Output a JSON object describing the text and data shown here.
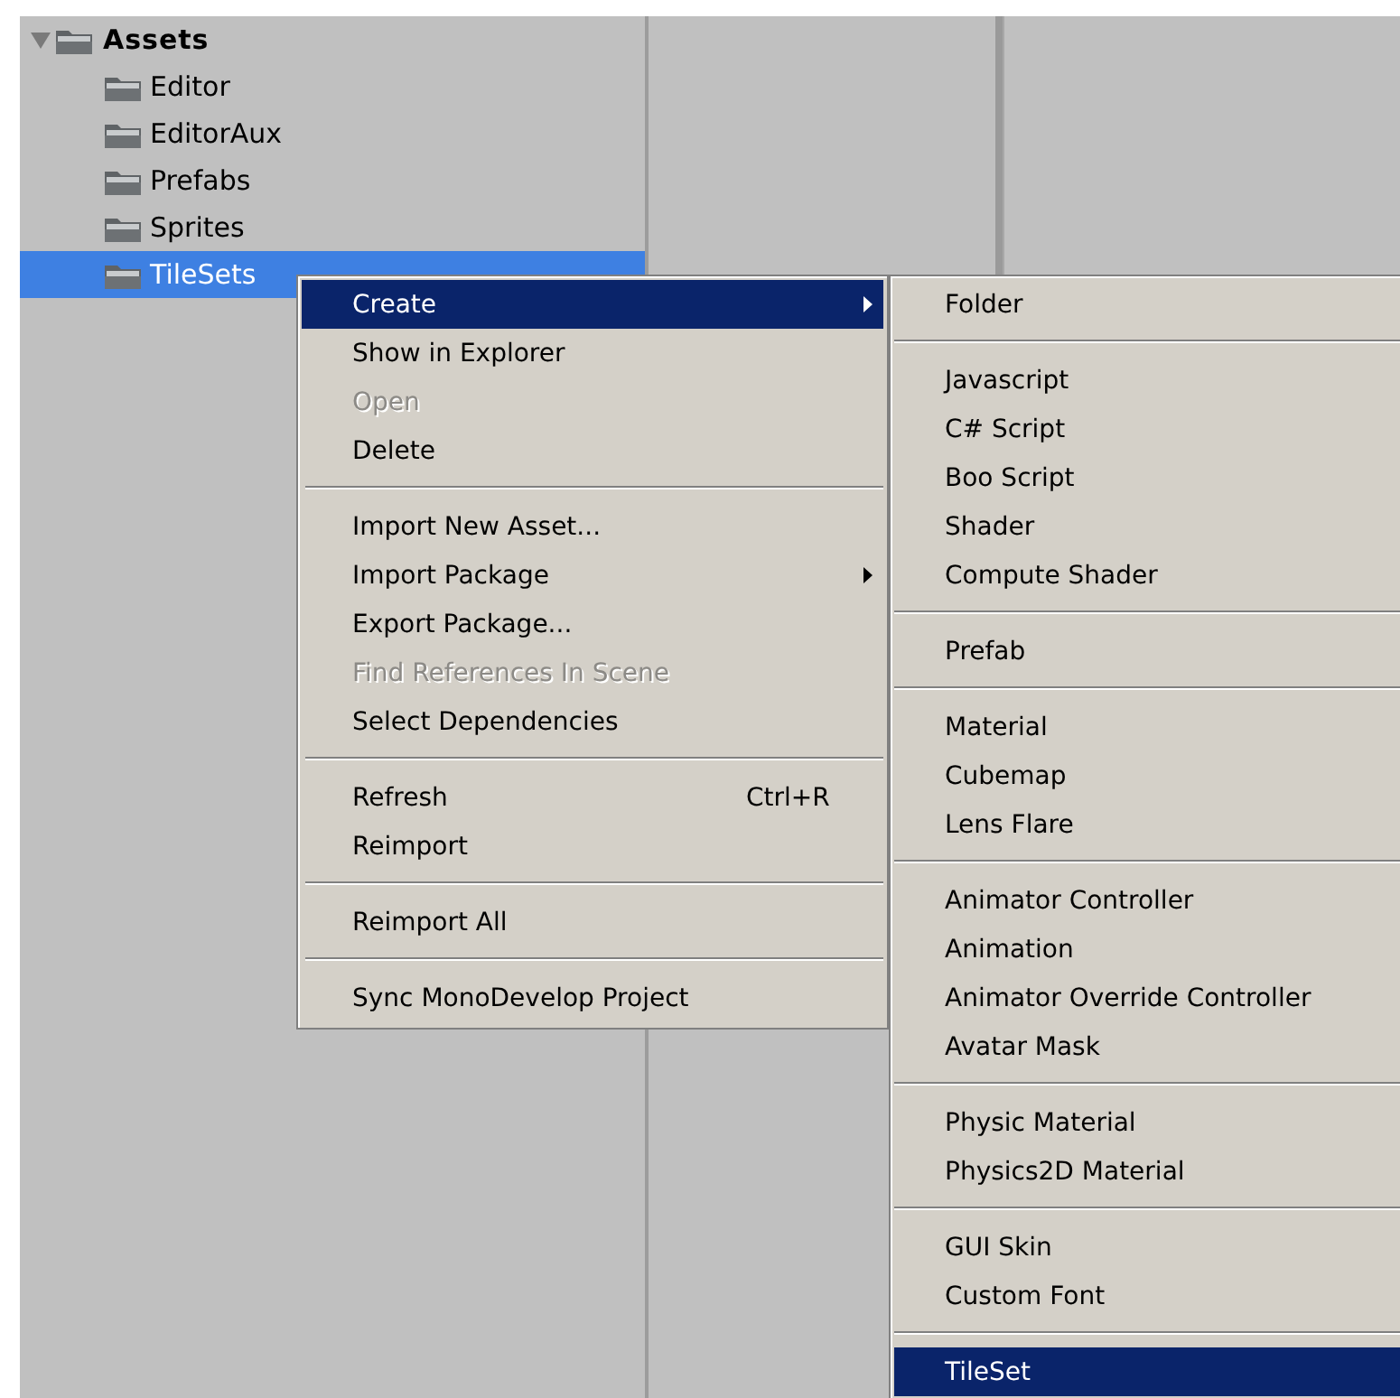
{
  "tree": {
    "root": {
      "label": "Assets",
      "expanded": true,
      "selected": false,
      "children": [
        {
          "label": "Editor",
          "selected": false
        },
        {
          "label": "EditorAux",
          "selected": false
        },
        {
          "label": "Prefabs",
          "selected": false
        },
        {
          "label": "Sprites",
          "selected": false
        },
        {
          "label": "TileSets",
          "selected": true
        }
      ]
    }
  },
  "context_menu": {
    "items": [
      {
        "kind": "item",
        "label": "Create",
        "selected": true,
        "disabled": false,
        "submenu": true
      },
      {
        "kind": "item",
        "label": "Show in Explorer",
        "selected": false,
        "disabled": false,
        "submenu": false
      },
      {
        "kind": "item",
        "label": "Open",
        "selected": false,
        "disabled": true,
        "submenu": false
      },
      {
        "kind": "item",
        "label": "Delete",
        "selected": false,
        "disabled": false,
        "submenu": false
      },
      {
        "kind": "separator"
      },
      {
        "kind": "item",
        "label": "Import New Asset...",
        "selected": false,
        "disabled": false,
        "submenu": false
      },
      {
        "kind": "item",
        "label": "Import Package",
        "selected": false,
        "disabled": false,
        "submenu": true
      },
      {
        "kind": "item",
        "label": "Export Package...",
        "selected": false,
        "disabled": false,
        "submenu": false
      },
      {
        "kind": "item",
        "label": "Find References In Scene",
        "selected": false,
        "disabled": true,
        "submenu": false
      },
      {
        "kind": "item",
        "label": "Select Dependencies",
        "selected": false,
        "disabled": false,
        "submenu": false
      },
      {
        "kind": "separator"
      },
      {
        "kind": "item",
        "label": "Refresh",
        "shortcut": "Ctrl+R",
        "selected": false,
        "disabled": false,
        "submenu": false
      },
      {
        "kind": "item",
        "label": "Reimport",
        "selected": false,
        "disabled": false,
        "submenu": false
      },
      {
        "kind": "separator"
      },
      {
        "kind": "item",
        "label": "Reimport All",
        "selected": false,
        "disabled": false,
        "submenu": false
      },
      {
        "kind": "separator"
      },
      {
        "kind": "item",
        "label": "Sync MonoDevelop Project",
        "selected": false,
        "disabled": false,
        "submenu": false
      }
    ]
  },
  "create_submenu": {
    "items": [
      {
        "kind": "item",
        "label": "Folder",
        "selected": false,
        "disabled": false
      },
      {
        "kind": "separator"
      },
      {
        "kind": "item",
        "label": "Javascript",
        "selected": false,
        "disabled": false
      },
      {
        "kind": "item",
        "label": "C# Script",
        "selected": false,
        "disabled": false
      },
      {
        "kind": "item",
        "label": "Boo Script",
        "selected": false,
        "disabled": false
      },
      {
        "kind": "item",
        "label": "Shader",
        "selected": false,
        "disabled": false
      },
      {
        "kind": "item",
        "label": "Compute Shader",
        "selected": false,
        "disabled": false
      },
      {
        "kind": "separator"
      },
      {
        "kind": "item",
        "label": "Prefab",
        "selected": false,
        "disabled": false
      },
      {
        "kind": "separator"
      },
      {
        "kind": "item",
        "label": "Material",
        "selected": false,
        "disabled": false
      },
      {
        "kind": "item",
        "label": "Cubemap",
        "selected": false,
        "disabled": false
      },
      {
        "kind": "item",
        "label": "Lens Flare",
        "selected": false,
        "disabled": false
      },
      {
        "kind": "separator"
      },
      {
        "kind": "item",
        "label": "Animator Controller",
        "selected": false,
        "disabled": false
      },
      {
        "kind": "item",
        "label": "Animation",
        "selected": false,
        "disabled": false
      },
      {
        "kind": "item",
        "label": "Animator Override Controller",
        "selected": false,
        "disabled": false
      },
      {
        "kind": "item",
        "label": "Avatar Mask",
        "selected": false,
        "disabled": false
      },
      {
        "kind": "separator"
      },
      {
        "kind": "item",
        "label": "Physic Material",
        "selected": false,
        "disabled": false
      },
      {
        "kind": "item",
        "label": "Physics2D Material",
        "selected": false,
        "disabled": false
      },
      {
        "kind": "separator"
      },
      {
        "kind": "item",
        "label": "GUI Skin",
        "selected": false,
        "disabled": false
      },
      {
        "kind": "item",
        "label": "Custom Font",
        "selected": false,
        "disabled": false
      },
      {
        "kind": "separator"
      },
      {
        "kind": "item",
        "label": "TileSet",
        "selected": true,
        "disabled": false
      }
    ]
  }
}
